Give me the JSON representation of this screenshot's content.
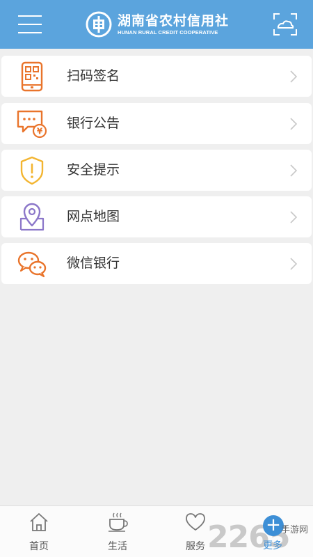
{
  "header": {
    "title_cn": "湖南省农村信用社",
    "title_en": "HUNAN RURAL CREDIT COOPERATIVE",
    "menu_icon": "hamburger-menu-icon",
    "scan_icon": "scan-icon"
  },
  "menu": {
    "items": [
      {
        "label": "扫码签名",
        "icon": "qr-phone-icon",
        "color": "#e9742b"
      },
      {
        "label": "银行公告",
        "icon": "announcement-chat-icon",
        "color": "#e9742b"
      },
      {
        "label": "安全提示",
        "icon": "shield-icon",
        "color": "#f3b531"
      },
      {
        "label": "网点地图",
        "icon": "map-pin-icon",
        "color": "#8b76c9"
      },
      {
        "label": "微信银行",
        "icon": "wechat-icon",
        "color": "#e9742b"
      }
    ]
  },
  "tabs": [
    {
      "label": "首页",
      "icon": "home-icon"
    },
    {
      "label": "生活",
      "icon": "coffee-cup-icon"
    },
    {
      "label": "服务",
      "icon": "heart-icon"
    },
    {
      "label": "更多",
      "icon": "plus-icon"
    }
  ],
  "watermark": {
    "number": "2265",
    "text": "手游网"
  },
  "colors": {
    "header": "#5ba4dd",
    "background": "#efefef",
    "accent_blue": "#3d8fd6"
  }
}
